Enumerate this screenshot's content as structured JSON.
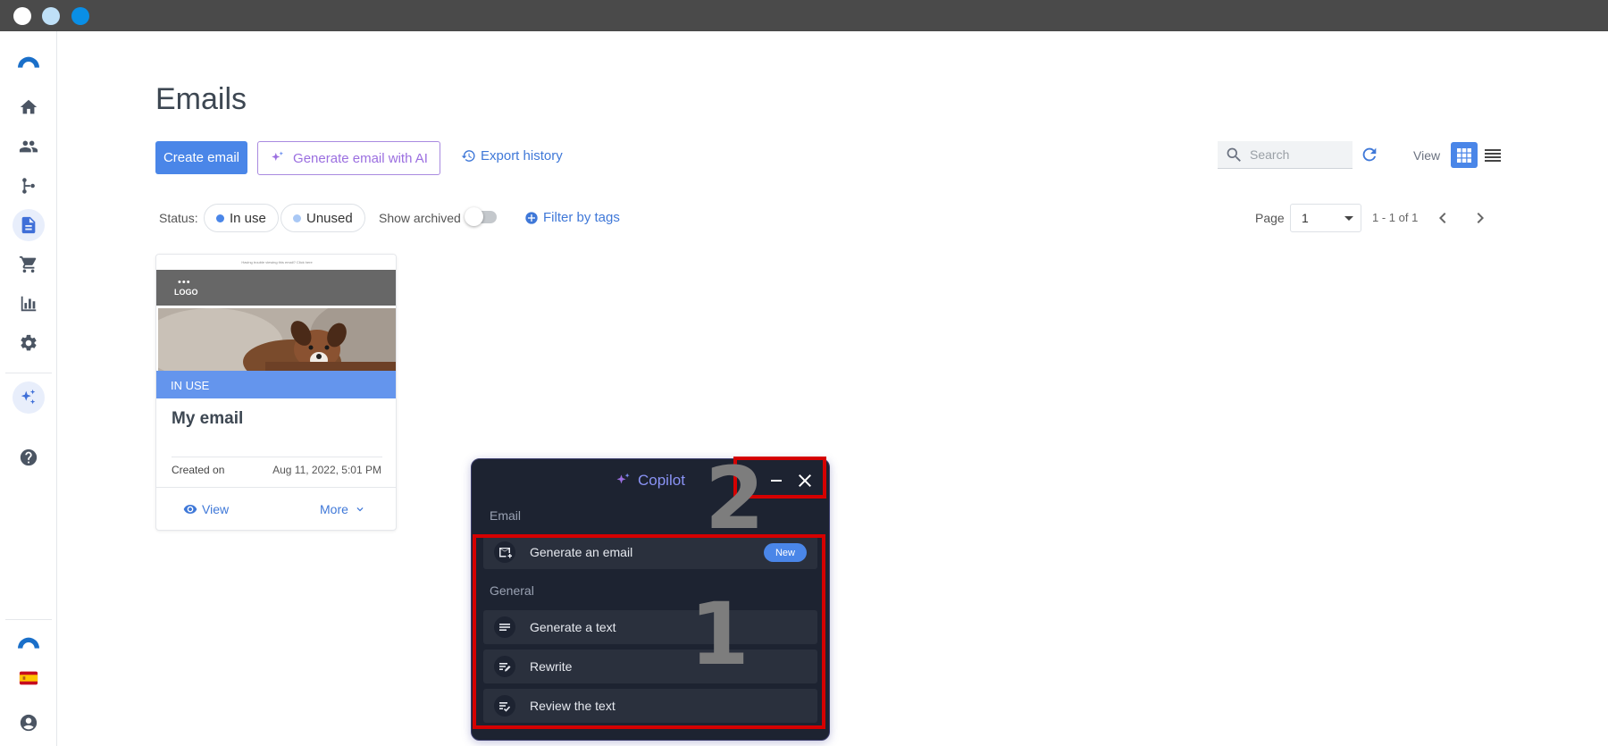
{
  "window": {
    "controls": [
      {
        "name": "close-dot",
        "color": "#ffffff"
      },
      {
        "name": "minimize-dot",
        "color": "#bfe0f7"
      },
      {
        "name": "maximize-dot",
        "color": "#0a8fe6"
      }
    ]
  },
  "sidebar": {
    "items": [
      {
        "name": "sidebar-brand-logo",
        "icon": "brand-arc-icon"
      },
      {
        "name": "sidebar-item-home",
        "icon": "home-icon"
      },
      {
        "name": "sidebar-item-contacts",
        "icon": "people-icon"
      },
      {
        "name": "sidebar-item-automations",
        "icon": "branch-icon"
      },
      {
        "name": "sidebar-item-emails",
        "icon": "document-icon",
        "active": true
      },
      {
        "name": "sidebar-item-ecommerce",
        "icon": "cart-icon"
      },
      {
        "name": "sidebar-item-reports",
        "icon": "bar-chart-icon"
      },
      {
        "name": "sidebar-item-settings",
        "icon": "gear-icon"
      },
      {
        "name": "sidebar-item-ai",
        "icon": "sparkles-icon"
      },
      {
        "name": "sidebar-item-help",
        "icon": "help-icon"
      }
    ],
    "bottom": [
      {
        "name": "sidebar-brand-logo-bottom",
        "icon": "brand-arc-icon"
      },
      {
        "name": "language-flag",
        "icon": "spain-flag-icon"
      },
      {
        "name": "account-button",
        "icon": "account-icon"
      }
    ]
  },
  "page": {
    "title": "Emails"
  },
  "toolbar": {
    "create_label": "Create email",
    "generate_ai_label": "Generate email with AI",
    "export_label": "Export history",
    "search_placeholder": "Search",
    "view_label": "View"
  },
  "filters": {
    "status_label": "Status:",
    "in_use_label": "In use",
    "unused_label": "Unused",
    "archived_label": "Show archived",
    "archived_on": false,
    "filter_tags_label": "Filter by tags"
  },
  "pagination": {
    "page_label": "Page",
    "page_value": "1",
    "range_text": "1 - 1 of 1"
  },
  "card": {
    "preview_top_text": "Having trouble viewing this email? Click here",
    "preview_logo": "LOGO",
    "preview_dots": "•••",
    "status": "IN USE",
    "title": "My email",
    "created_label": "Created on",
    "created_value": "Aug 11, 2022, 5:01 PM",
    "view_label": "View",
    "more_label": "More"
  },
  "copilot": {
    "title": "Copilot",
    "section_email": "Email",
    "section_general": "General",
    "items": [
      {
        "label": "Generate an email",
        "icon": "email-add-icon",
        "badge": "New"
      },
      {
        "label": "Generate a text",
        "icon": "text-lines-icon"
      },
      {
        "label": "Rewrite",
        "icon": "rewrite-icon"
      },
      {
        "label": "Review the text",
        "icon": "review-check-icon"
      }
    ]
  },
  "annotations": {
    "label_1": "1",
    "label_2": "2",
    "color": "#d50000"
  },
  "colors": {
    "primary": "#4a86e8",
    "ai_accent": "#9b6fe0",
    "link": "#3f78d8",
    "copilot_bg": "#1d2331",
    "in_use_dot": "#4a86e8",
    "unused_dot": "#a9c8f5"
  }
}
